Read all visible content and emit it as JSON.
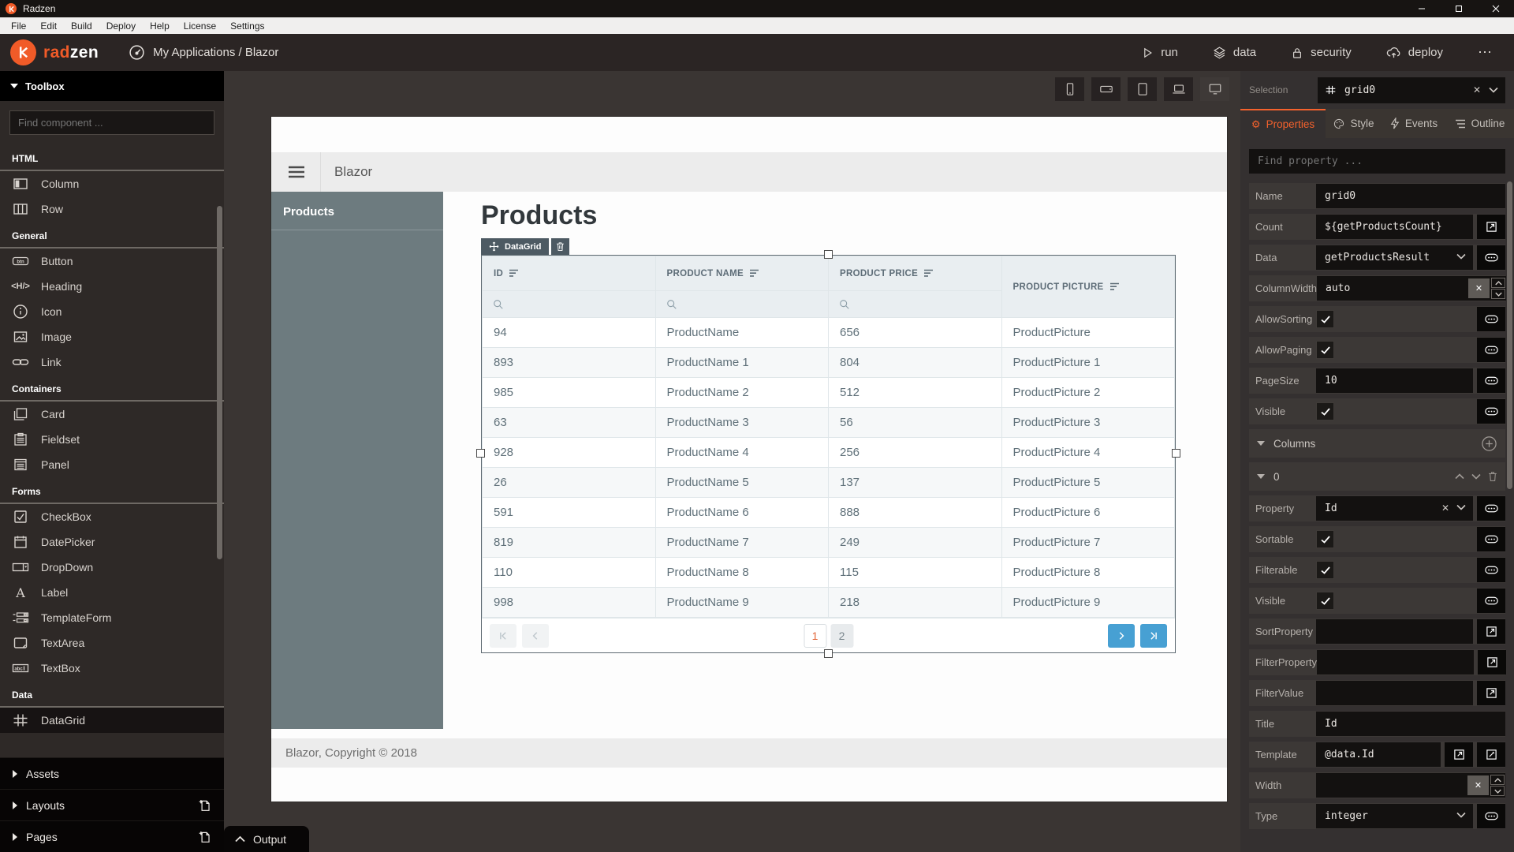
{
  "window": {
    "title": "Radzen"
  },
  "menu": {
    "items": [
      "File",
      "Edit",
      "Build",
      "Deploy",
      "Help",
      "License",
      "Settings"
    ]
  },
  "toolbar": {
    "brand_rad": "rad",
    "brand_zen": "zen",
    "breadcrumb": "My Applications / Blazor",
    "run": "run",
    "data": "data",
    "security": "security",
    "deploy": "deploy",
    "more": "⋯"
  },
  "toolbox": {
    "header": "Toolbox",
    "search_placeholder": "Find component ...",
    "sections": [
      {
        "name": "HTML",
        "items": [
          {
            "label": "Column"
          },
          {
            "label": "Row"
          }
        ]
      },
      {
        "name": "General",
        "items": [
          {
            "label": "Button"
          },
          {
            "label": "Heading"
          },
          {
            "label": "Icon"
          },
          {
            "label": "Image"
          },
          {
            "label": "Link"
          }
        ]
      },
      {
        "name": "Containers",
        "items": [
          {
            "label": "Card"
          },
          {
            "label": "Fieldset"
          },
          {
            "label": "Panel"
          }
        ]
      },
      {
        "name": "Forms",
        "items": [
          {
            "label": "CheckBox"
          },
          {
            "label": "DatePicker"
          },
          {
            "label": "DropDown"
          },
          {
            "label": "Label"
          },
          {
            "label": "TemplateForm"
          },
          {
            "label": "TextArea"
          },
          {
            "label": "TextBox"
          }
        ]
      },
      {
        "name": "Data",
        "items": [
          {
            "label": "DataGrid"
          }
        ]
      }
    ]
  },
  "sidebar_bottom": {
    "assets": "Assets",
    "layouts": "Layouts",
    "pages": "Pages"
  },
  "output": {
    "label": "Output"
  },
  "canvas": {
    "page": {
      "app_title": "Blazor",
      "nav_item": "Products",
      "heading": "Products",
      "chip_label": "DataGrid",
      "footer": "Blazor, Copyright © 2018"
    },
    "grid": {
      "columns": [
        "ID",
        "PRODUCT NAME",
        "PRODUCT PRICE",
        "PRODUCT PICTURE"
      ],
      "rows": [
        [
          "94",
          "ProductName",
          "656",
          "ProductPicture"
        ],
        [
          "893",
          "ProductName 1",
          "804",
          "ProductPicture 1"
        ],
        [
          "985",
          "ProductName 2",
          "512",
          "ProductPicture 2"
        ],
        [
          "63",
          "ProductName 3",
          "56",
          "ProductPicture 3"
        ],
        [
          "928",
          "ProductName 4",
          "256",
          "ProductPicture 4"
        ],
        [
          "26",
          "ProductName 5",
          "137",
          "ProductPicture 5"
        ],
        [
          "591",
          "ProductName 6",
          "888",
          "ProductPicture 6"
        ],
        [
          "819",
          "ProductName 7",
          "249",
          "ProductPicture 7"
        ],
        [
          "110",
          "ProductName 8",
          "115",
          "ProductPicture 8"
        ],
        [
          "998",
          "ProductName 9",
          "218",
          "ProductPicture 9"
        ]
      ],
      "pager": {
        "page1": "1",
        "page2": "2",
        "current": "1"
      }
    }
  },
  "inspector": {
    "selection_label": "Selection",
    "selection_value": "grid0",
    "tabs": {
      "properties": "Properties",
      "style": "Style",
      "events": "Events",
      "outline": "Outline"
    },
    "search_placeholder": "Find property ...",
    "props": {
      "name_label": "Name",
      "name_value": "grid0",
      "count_label": "Count",
      "count_value": "${getProductsCount}",
      "data_label": "Data",
      "data_value": "getProductsResult",
      "columnwidth_label": "ColumnWidth",
      "columnwidth_value": "auto",
      "allowsorting_label": "AllowSorting",
      "allowsorting_checked": true,
      "allowpaging_label": "AllowPaging",
      "allowpaging_checked": true,
      "pagesize_label": "PageSize",
      "pagesize_value": "10",
      "visible_label": "Visible",
      "visible_checked": true,
      "columns_label": "Columns",
      "column_index": "0",
      "property_label": "Property",
      "property_value": "Id",
      "sortable_label": "Sortable",
      "sortable_checked": true,
      "filterable_label": "Filterable",
      "filterable_checked": true,
      "visible2_label": "Visible",
      "visible2_checked": true,
      "sortproperty_label": "SortProperty",
      "sortproperty_value": "",
      "filterproperty_label": "FilterProperty",
      "filterproperty_value": "",
      "filtervalue_label": "FilterValue",
      "filtervalue_value": "",
      "title_label": "Title",
      "title_value": "Id",
      "template_label": "Template",
      "template_value": "@data.Id",
      "width_label": "Width",
      "width_value": "",
      "type_label": "Type",
      "type_value": "integer"
    }
  },
  "colors": {
    "accent": "#f15b28",
    "pager_blue": "#47a0d3"
  }
}
